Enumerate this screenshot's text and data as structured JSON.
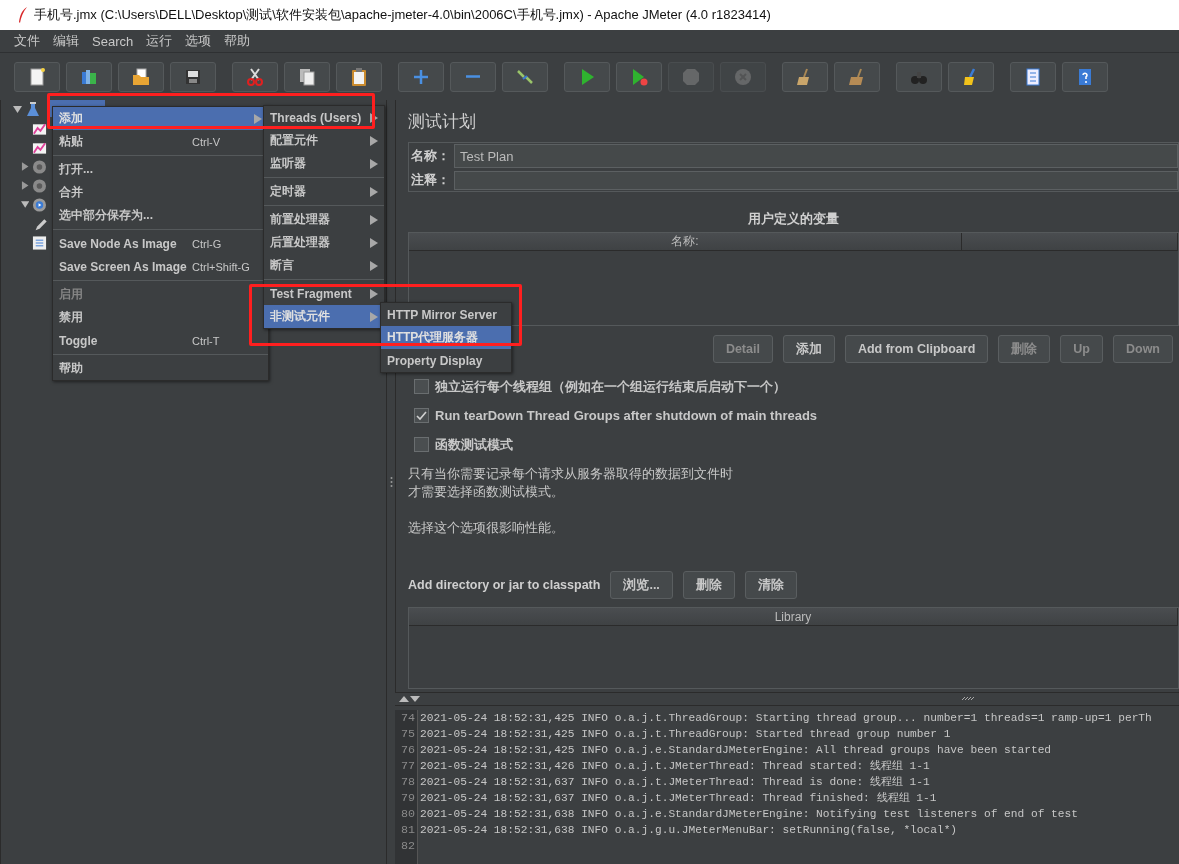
{
  "window": {
    "title": "手机号.jmx (C:\\Users\\DELL\\Desktop\\测试\\软件安装包\\apache-jmeter-4.0\\bin\\2006C\\手机号.jmx) - Apache JMeter (4.0 r1823414)"
  },
  "menu_bar": [
    "文件",
    "编辑",
    "Search",
    "运行",
    "选项",
    "帮助"
  ],
  "toolbar": [
    [
      {
        "disabled": false
      },
      {
        "disabled": false
      },
      {
        "disabled": false
      },
      {
        "disabled": false
      }
    ],
    [
      {
        "disabled": false
      },
      {
        "disabled": false
      },
      {
        "disabled": false
      }
    ],
    [
      {
        "disabled": false
      },
      {
        "disabled": false
      },
      {
        "disabled": false
      }
    ],
    [
      {
        "disabled": false
      },
      {
        "disabled": false
      },
      {
        "disabled": true
      },
      {
        "disabled": true
      }
    ],
    [
      {
        "disabled": false
      },
      {
        "disabled": false
      }
    ],
    [
      {
        "disabled": false
      },
      {
        "disabled": false
      }
    ],
    [
      {
        "disabled": false
      },
      {
        "disabled": false
      }
    ]
  ],
  "tree": [
    {
      "kind": "plan",
      "expanded": true,
      "selected": true,
      "children": [
        {
          "kind": "listener"
        },
        {
          "kind": "listener"
        },
        {
          "kind": "config",
          "expanded": false
        },
        {
          "kind": "config",
          "expanded": false
        },
        {
          "kind": "thread-group",
          "expanded": true,
          "children": [
            {
              "kind": "sampler"
            }
          ]
        },
        {
          "kind": "report"
        }
      ]
    }
  ],
  "context_menu": {
    "items": [
      {
        "kind": "item",
        "label": "添加",
        "submenu": true,
        "selected": true,
        "disabled": false
      },
      {
        "kind": "item",
        "label": "粘贴",
        "shortcut": "Ctrl-V",
        "submenu": false,
        "selected": false,
        "disabled": false
      },
      {
        "kind": "separator"
      },
      {
        "kind": "item",
        "label": "打开...",
        "submenu": false,
        "selected": false,
        "disabled": false
      },
      {
        "kind": "item",
        "label": "合并",
        "submenu": false,
        "selected": false,
        "disabled": false
      },
      {
        "kind": "item",
        "label": "选中部分保存为...",
        "submenu": false,
        "selected": false,
        "disabled": false
      },
      {
        "kind": "separator"
      },
      {
        "kind": "item",
        "label": "Save Node As Image",
        "shortcut": "Ctrl-G",
        "submenu": false,
        "selected": false,
        "disabled": false
      },
      {
        "kind": "item",
        "label": "Save Screen As Image",
        "shortcut": "Ctrl+Shift-G",
        "submenu": false,
        "selected": false,
        "disabled": false
      },
      {
        "kind": "separator"
      },
      {
        "kind": "item",
        "label": "启用",
        "submenu": false,
        "selected": false,
        "disabled": true
      },
      {
        "kind": "item",
        "label": "禁用",
        "submenu": false,
        "selected": false,
        "disabled": false
      },
      {
        "kind": "item",
        "label": "Toggle",
        "shortcut": "Ctrl-T",
        "submenu": false,
        "selected": false,
        "disabled": false
      },
      {
        "kind": "separator"
      },
      {
        "kind": "item",
        "label": "帮助",
        "submenu": false,
        "selected": false,
        "disabled": false
      }
    ]
  },
  "add_submenu": {
    "items": [
      {
        "kind": "item",
        "label": "Threads (Users)",
        "submenu": true,
        "selected": false,
        "disabled": false
      },
      {
        "kind": "item",
        "label": "配置元件",
        "submenu": true,
        "selected": false,
        "disabled": false
      },
      {
        "kind": "item",
        "label": "监听器",
        "submenu": true,
        "selected": false,
        "disabled": false
      },
      {
        "kind": "separator"
      },
      {
        "kind": "item",
        "label": "定时器",
        "submenu": true,
        "selected": false,
        "disabled": false
      },
      {
        "kind": "separator"
      },
      {
        "kind": "item",
        "label": "前置处理器",
        "submenu": true,
        "selected": false,
        "disabled": false
      },
      {
        "kind": "item",
        "label": "后置处理器",
        "submenu": true,
        "selected": false,
        "disabled": false
      },
      {
        "kind": "item",
        "label": "断言",
        "submenu": true,
        "selected": false,
        "disabled": false
      },
      {
        "kind": "separator"
      },
      {
        "kind": "item",
        "label": "Test Fragment",
        "submenu": true,
        "selected": false,
        "disabled": false
      },
      {
        "kind": "item",
        "label": "非测试元件",
        "submenu": true,
        "selected": true,
        "disabled": false
      }
    ]
  },
  "non_test_submenu": {
    "items": [
      {
        "kind": "item",
        "label": "HTTP Mirror Server",
        "submenu": false,
        "selected": false,
        "disabled": false
      },
      {
        "kind": "item",
        "label": "HTTP代理服务器",
        "submenu": false,
        "selected": true,
        "disabled": false
      },
      {
        "kind": "item",
        "label": "Property Display",
        "submenu": false,
        "selected": false,
        "disabled": false
      }
    ]
  },
  "test_plan": {
    "title": "测试计划",
    "name_label": "名称：",
    "name_value": "Test Plan",
    "comment_label": "注释：",
    "variables": {
      "title": "用户定义的变量",
      "columns": [
        "名称:"
      ],
      "buttons": [
        {
          "label": "Detail",
          "disabled": true
        },
        {
          "label": "添加",
          "disabled": false
        },
        {
          "label": "Add from Clipboard",
          "disabled": false
        },
        {
          "label": "删除",
          "disabled": true
        },
        {
          "label": "Up",
          "disabled": true
        },
        {
          "label": "Down",
          "disabled": true
        }
      ]
    },
    "options": [
      {
        "label": "独立运行每个线程组（例如在一个组运行结束后启动下一个）",
        "checked": false
      },
      {
        "label": "Run tearDown Thread Groups after shutdown of main threads",
        "checked": true
      },
      {
        "label": "函数测试模式",
        "checked": false
      }
    ],
    "help_text": [
      {
        "lines": [
          "只有当你需要记录每个请求从服务器取得的数据到文件时",
          "才需要选择函数测试模式。"
        ]
      },
      {
        "lines": [
          "选择这个选项很影响性能。"
        ]
      }
    ],
    "classpath": {
      "label": "Add directory or jar to classpath",
      "buttons": [
        {
          "label": "浏览...",
          "disabled": false
        },
        {
          "label": "删除",
          "disabled": false
        },
        {
          "label": "清除",
          "disabled": false
        }
      ],
      "columns": [
        "Library"
      ]
    }
  },
  "log": {
    "lines": [
      {
        "number": "74",
        "text": "2021-05-24 18:52:31,425 INFO o.a.j.t.ThreadGroup: Starting thread group... number=1 threads=1 ramp-up=1 perTh"
      },
      {
        "number": "75",
        "text": "2021-05-24 18:52:31,425 INFO o.a.j.t.ThreadGroup: Started thread group number 1"
      },
      {
        "number": "76",
        "text": "2021-05-24 18:52:31,425 INFO o.a.j.e.StandardJMeterEngine: All thread groups have been started"
      },
      {
        "number": "77",
        "text": "2021-05-24 18:52:31,426 INFO o.a.j.t.JMeterThread: Thread started: 线程组 1-1"
      },
      {
        "number": "78",
        "text": "2021-05-24 18:52:31,637 INFO o.a.j.t.JMeterThread: Thread is done: 线程组 1-1"
      },
      {
        "number": "79",
        "text": "2021-05-24 18:52:31,637 INFO o.a.j.t.JMeterThread: Thread finished: 线程组 1-1"
      },
      {
        "number": "80",
        "text": "2021-05-24 18:52:31,638 INFO o.a.j.e.StandardJMeterEngine: Notifying test listeners of end of test"
      },
      {
        "number": "81",
        "text": "2021-05-24 18:52:31,638 INFO o.a.j.g.u.JMeterMenuBar: setRunning(false, *local*)"
      },
      {
        "number": "82"
      }
    ]
  }
}
